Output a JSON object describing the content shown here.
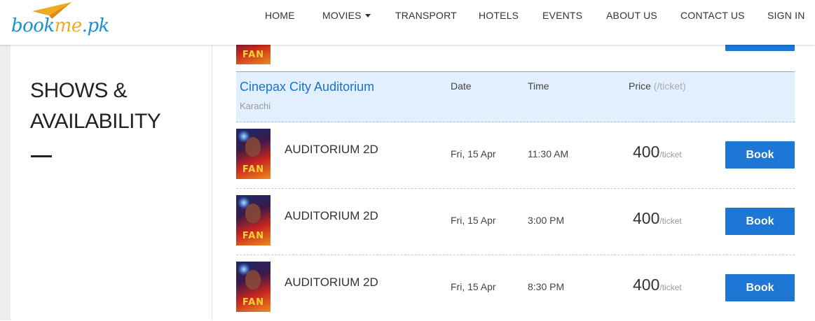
{
  "brand": {
    "logo_text_1": "book",
    "logo_text_2": "me",
    "logo_text_3": ".pk",
    "colors": {
      "blue": "#1a8fd2",
      "orange": "#f4a81d"
    }
  },
  "nav": {
    "items": [
      {
        "label": "HOME"
      },
      {
        "label": "MOVIES",
        "has_dropdown": true
      },
      {
        "label": "TRANSPORT"
      },
      {
        "label": "HOTELS"
      },
      {
        "label": "EVENTS"
      },
      {
        "label": "ABOUT US"
      },
      {
        "label": "CONTACT US"
      },
      {
        "label": "SIGN IN"
      }
    ]
  },
  "sidebar": {
    "title": "SHOWS & AVAILABILITY"
  },
  "poster_text": "FAN",
  "venue": {
    "name": "Cinepax City Auditorium",
    "city": "Karachi",
    "columns": {
      "date": "Date",
      "time": "Time",
      "price": "Price",
      "price_unit": "(/ticket)"
    }
  },
  "shows": [
    {
      "hall": "AUDITORIUM 2D",
      "date": "Fri, 15 Apr",
      "time": "11:30 AM",
      "price": "400",
      "unit": "/ticket",
      "button": "Book"
    },
    {
      "hall": "AUDITORIUM 2D",
      "date": "Fri, 15 Apr",
      "time": "3:00 PM",
      "price": "400",
      "unit": "/ticket",
      "button": "Book"
    },
    {
      "hall": "AUDITORIUM 2D",
      "date": "Fri, 15 Apr",
      "time": "8:30 PM",
      "price": "400",
      "unit": "/ticket",
      "button": "Book"
    }
  ],
  "accent_color": "#1e77d4"
}
